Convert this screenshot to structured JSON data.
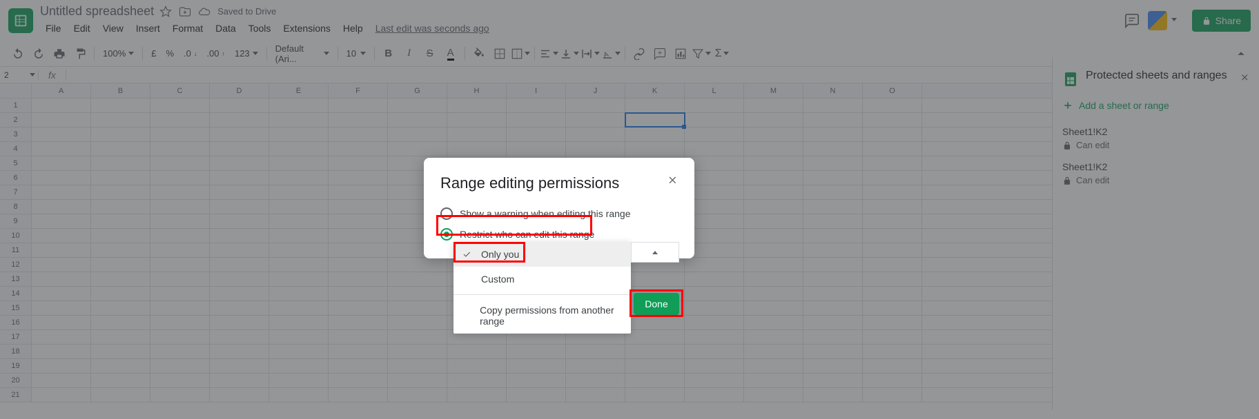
{
  "doc": {
    "title": "Untitled spreadsheet",
    "saved_text": "Saved to Drive"
  },
  "menu": {
    "file": "File",
    "edit": "Edit",
    "view": "View",
    "insert": "Insert",
    "format": "Format",
    "data": "Data",
    "tools": "Tools",
    "extensions": "Extensions",
    "help": "Help",
    "last_edit": "Last edit was seconds ago"
  },
  "share_label": "Share",
  "toolbar": {
    "zoom": "100%",
    "currency": "£",
    "percent": "%",
    "dec_dec": ".0",
    "inc_dec": ".00",
    "numfmt": "123",
    "font": "Default (Ari...",
    "font_size": "10"
  },
  "name_box": "2",
  "columns": [
    "A",
    "B",
    "C",
    "D",
    "E",
    "F",
    "G",
    "H",
    "I",
    "J",
    "K",
    "L",
    "M",
    "N",
    "O"
  ],
  "rows": [
    1,
    2,
    3,
    4,
    5,
    6,
    7,
    8,
    9,
    10,
    11,
    12,
    13,
    14,
    15,
    16,
    17,
    18,
    19,
    20,
    21
  ],
  "selected_cell": "K2",
  "sidebar": {
    "title": "Protected sheets and ranges",
    "add_label": "Add a sheet or range",
    "items": [
      {
        "title": "Sheet1!K2",
        "sub": "Can edit"
      },
      {
        "title": "Sheet1!K2",
        "sub": "Can edit"
      }
    ]
  },
  "dialog": {
    "title": "Range editing permissions",
    "option_warning": "Show a warning when editing this range",
    "option_restrict": "Restrict who can edit this range",
    "dd_only_you": "Only you",
    "dd_custom": "Custom",
    "dd_copy": "Copy permissions from another range",
    "done": "Done"
  }
}
